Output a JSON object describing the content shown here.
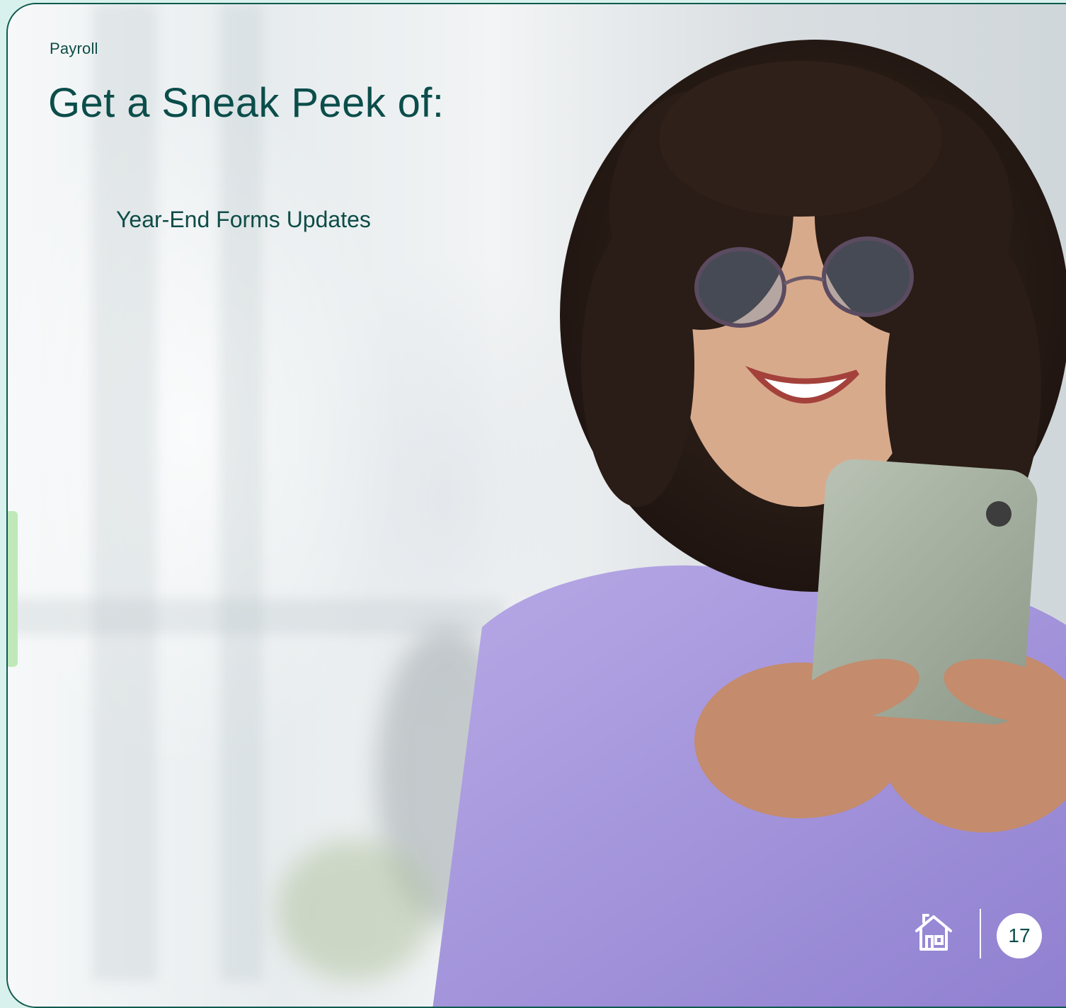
{
  "slide": {
    "section_label": "Payroll",
    "title": "Get a Sneak Peek of:",
    "items": [
      {
        "label": "Year-End Forms Updates"
      }
    ],
    "page_number": "17"
  },
  "icons": {
    "home": "home-icon"
  },
  "colors": {
    "title_text": "#0b4d4a",
    "frame_border": "#0f5a4f",
    "accent_tab": "#bfe9b9",
    "page_badge_bg": "#ffffff"
  }
}
